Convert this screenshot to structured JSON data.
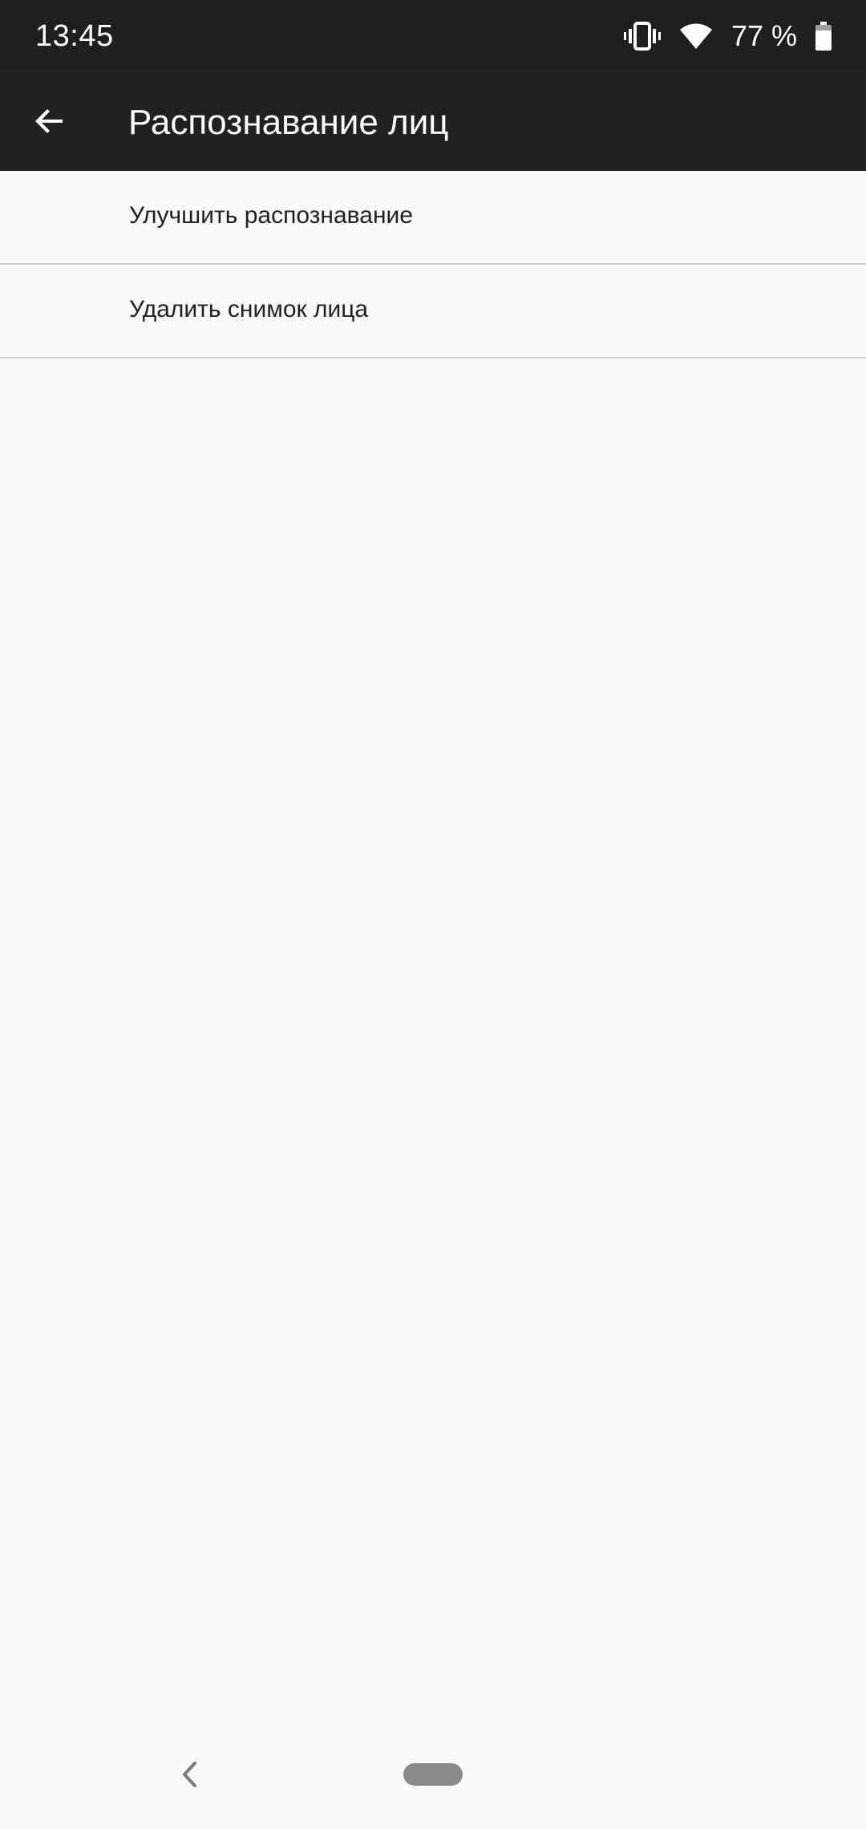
{
  "status_bar": {
    "time": "13:45",
    "battery_percent_text": "77 %",
    "battery_level": 0.77,
    "icons": [
      "vibrate-icon",
      "wifi-icon",
      "battery-icon"
    ]
  },
  "app_bar": {
    "title": "Распознавание лиц",
    "back_icon": "arrow-left-icon"
  },
  "list": {
    "items": [
      {
        "label": "Улучшить распознавание"
      },
      {
        "label": "Удалить снимок лица"
      }
    ]
  },
  "nav_bar": {
    "icons": [
      "nav-back-icon",
      "nav-home-pill"
    ]
  },
  "colors": {
    "status_bar_bg": "#1f1f1f",
    "app_bar_bg": "#212121",
    "page_bg": "#fafafa",
    "divider": "#cfcfcf",
    "text_primary": "#212121"
  }
}
